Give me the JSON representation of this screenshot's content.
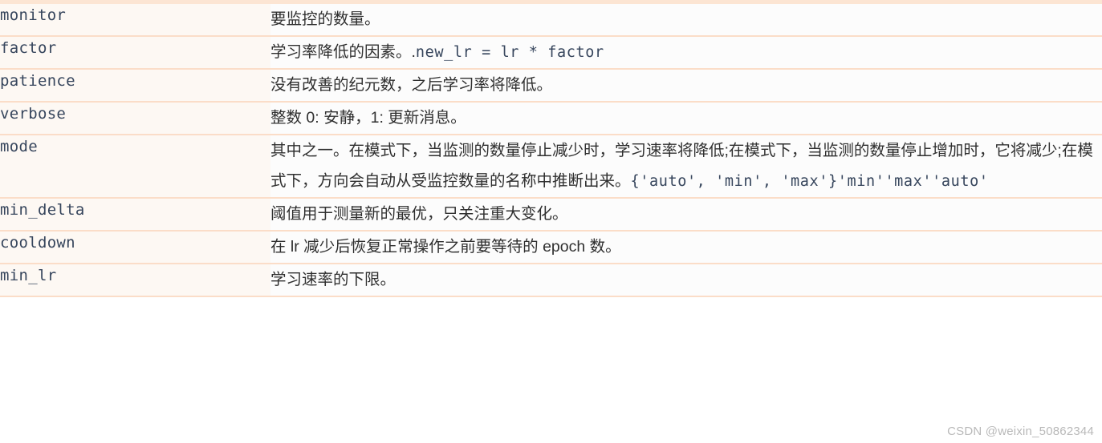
{
  "table": {
    "rows": [
      {
        "param": "monitor",
        "description": "要监控的数量。",
        "code": ""
      },
      {
        "param": "factor",
        "description": "学习率降低的因素。.",
        "code": "new_lr = lr * factor"
      },
      {
        "param": "patience",
        "description": "没有改善的纪元数，之后学习率将降低。",
        "code": ""
      },
      {
        "param": "verbose",
        "description": "整数 0: 安静，1: 更新消息。",
        "code": ""
      },
      {
        "param": "mode",
        "description": "其中之一。在模式下，当监测的数量停止减少时，学习速率将降低;在模式下，当监测的数量停止增加时，它将减少;在模式下，方向会自动从受监控数量的名称中推断出来。",
        "code": "{'auto', 'min', 'max'}'min''max''auto'"
      },
      {
        "param": "min_delta",
        "description": "阈值用于测量新的最优，只关注重大变化。",
        "code": ""
      },
      {
        "param": "cooldown",
        "description": "在 lr 减少后恢复正常操作之前要等待的 epoch 数。",
        "code": ""
      },
      {
        "param": "min_lr",
        "description": "学习速率的下限。",
        "code": ""
      }
    ]
  },
  "watermark": {
    "text": "CSDN @weixin_50862344"
  },
  "colors": {
    "border": "#fbddc8",
    "top_border": "#fce5d3",
    "param_cell_bg": "#fdf8f3",
    "desc_cell_bg": "#fcfcfc",
    "param_text": "#36455c",
    "desc_text": "#2f2f2f",
    "watermark_text": "#b9b9b9"
  }
}
